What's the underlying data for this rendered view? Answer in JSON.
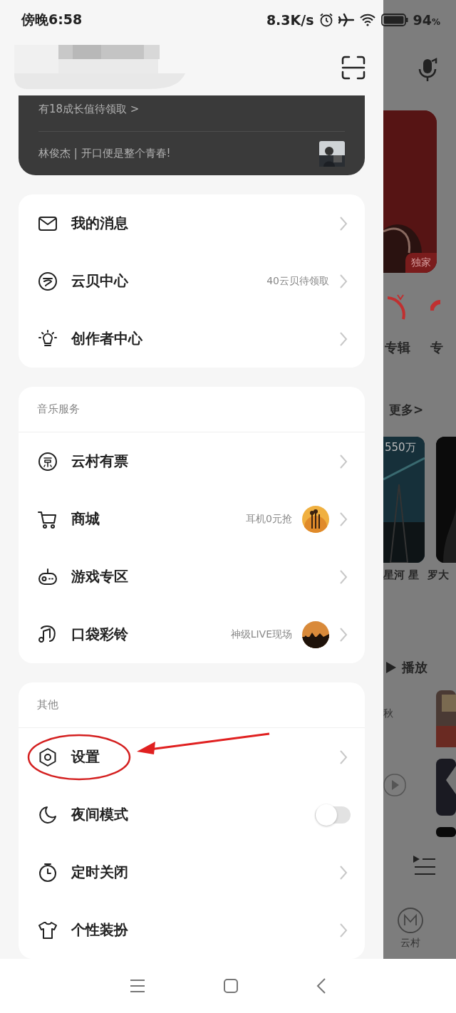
{
  "status_bar": {
    "time": "傍晚6:58",
    "speed": "8.3K/s",
    "battery": "94",
    "battery_unit": "%"
  },
  "vip_card": {
    "growth": "有18成长值待领取 >",
    "song": "林俊杰 | 开口便是整个青春!"
  },
  "menu_groups": [
    {
      "items": [
        {
          "kind": "link",
          "label": "我的消息"
        },
        {
          "kind": "link",
          "label": "云贝中心",
          "note": "40云贝待领取"
        },
        {
          "kind": "link",
          "label": "创作者中心"
        }
      ]
    },
    {
      "title": "音乐服务",
      "items": [
        {
          "kind": "link",
          "label": "云村有票"
        },
        {
          "kind": "link",
          "label": "商城",
          "note": "耳机0元抢"
        },
        {
          "kind": "link",
          "label": "游戏专区"
        },
        {
          "kind": "link",
          "label": "口袋彩铃",
          "note": "神级LIVE现场"
        }
      ]
    },
    {
      "title": "其他",
      "items": [
        {
          "kind": "link",
          "label": "设置",
          "annotated": true
        },
        {
          "kind": "toggle",
          "label": "夜间模式",
          "on": false
        },
        {
          "kind": "link",
          "label": "定时关闭"
        },
        {
          "kind": "link",
          "label": "个性装扮"
        }
      ]
    }
  ],
  "background_page": {
    "badge": "独家",
    "shortcuts": [
      "专辑",
      "专"
    ],
    "more": "更多>",
    "play_count": "550万",
    "playlist_titles": [
      "星河 星",
      "罗大"
    ],
    "play_all": "播放",
    "song_note": "秋",
    "tab": "云村"
  }
}
